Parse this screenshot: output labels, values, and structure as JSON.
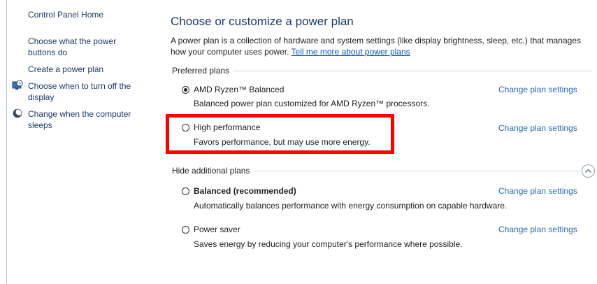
{
  "sidebar": {
    "home_label": "Control Panel Home",
    "items": [
      {
        "label": "Choose what the power buttons do",
        "icon": "none"
      },
      {
        "label": "Create a power plan",
        "icon": "none"
      },
      {
        "label": "Choose when to turn off the display",
        "icon": "monitor-clock-icon"
      },
      {
        "label": "Change when the computer sleeps",
        "icon": "moon-icon"
      }
    ]
  },
  "main": {
    "title": "Choose or customize a power plan",
    "description": "A power plan is a collection of hardware and system settings (like display brightness, sleep, etc.) that manages how your computer uses power.",
    "description_line1": "A power plan is a collection of hardware and system settings (like display brightness, sleep, etc.) that manages",
    "description_line2": "how your computer uses power.",
    "learn_more_link": "Tell me more about power plans",
    "preferred_label": "Preferred plans",
    "hide_label": "Hide additional plans",
    "change_link_label": "Change plan settings",
    "preferred_plans": [
      {
        "name": "AMD Ryzen™ Balanced",
        "description": "Balanced power plan customized for AMD Ryzen™ processors.",
        "selected": true,
        "bold": false
      },
      {
        "name": "High performance",
        "description": "Favors performance, but may use more energy.",
        "selected": false,
        "bold": false,
        "highlighted": true
      }
    ],
    "additional_plans": [
      {
        "name": "Balanced (recommended)",
        "description": "Automatically balances performance with energy consumption on capable hardware.",
        "selected": false,
        "bold": true
      },
      {
        "name": "Power saver",
        "description": "Saves energy by reducing your computer's performance where possible.",
        "selected": false,
        "bold": false
      }
    ]
  },
  "colors": {
    "highlight": "#ff0000",
    "link": "#2a6ab5",
    "title": "#1e3a6e"
  }
}
